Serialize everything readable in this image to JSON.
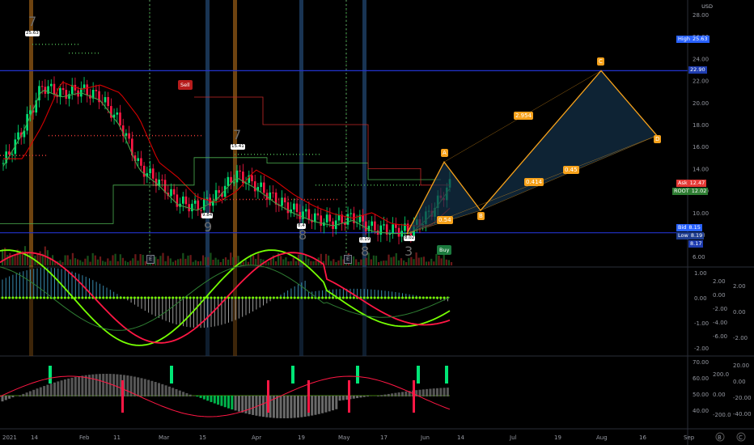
{
  "currency": "USD",
  "price_axis": {
    "labels": [
      "28.00",
      "26.00",
      "24.00",
      "22.00",
      "20.00",
      "18.00",
      "16.00",
      "14.00",
      "12.00",
      "10.00",
      "8.00",
      "6.00"
    ],
    "tags": {
      "high": {
        "k": "High",
        "v": "25.63",
        "color": "#2962ff"
      },
      "level_upper": {
        "v": "22.90",
        "color": "#1e3caf"
      },
      "ask": {
        "k": "Ask",
        "v": "12.47",
        "color": "#e53935"
      },
      "root": {
        "k": "ROOT",
        "v": "12.02",
        "color": "#2e7d32"
      },
      "bid": {
        "k": "Bid",
        "v": "8.15",
        "color": "#2962ff"
      },
      "low": {
        "k": "Low",
        "v": "8.19",
        "color": "#1e3c8f"
      },
      "level_lower": {
        "v": "8.17",
        "color": "#1e3caf"
      }
    }
  },
  "osc1_axis": {
    "left": [
      "1.00",
      "0.00",
      "-1.00",
      "-2.00"
    ],
    "mid": [
      "2.00",
      "0.00",
      "-2.00",
      "-4.00",
      "-6.00"
    ],
    "right": [
      "2.00",
      "0.00",
      "-2.00"
    ]
  },
  "osc2_axis": {
    "left": [
      "70.00",
      "60.00",
      "50.00",
      "40.00"
    ],
    "mid": [
      "200.0",
      "0.00",
      "-200.0"
    ],
    "right": [
      "20.00",
      "0.00",
      "-20.00",
      "-40.00"
    ]
  },
  "time_axis": [
    "2021",
    "14",
    "Feb",
    "11",
    "Mar",
    "15",
    "Apr",
    "19",
    "May",
    "17",
    "Jun",
    "14",
    "Jul",
    "19",
    "Aug",
    "16",
    "Sep"
  ],
  "time_icons": [
    "B",
    "C"
  ],
  "annotations": {
    "sell": "Sell",
    "buy": "Buy",
    "earnings": "E",
    "price_marks": [
      "25.63",
      "15.41",
      "9.84",
      "8.4",
      "8.19",
      "8.02"
    ],
    "count_marks": [
      "7",
      "7",
      "9",
      "8",
      "8",
      "3"
    ]
  },
  "harmonic": {
    "points": [
      "A",
      "B",
      "C",
      "D"
    ],
    "ratios": [
      "2.954",
      "0.414",
      "0.45",
      "0.54"
    ],
    "color": "#f7a21b"
  },
  "colors": {
    "bull": "#00e676",
    "bear": "#ff1744",
    "grid": "#1e222d",
    "accent": "#f7a21b"
  },
  "chart_data": {
    "type": "candlestick",
    "title": "",
    "ylim": [
      5.5,
      28
    ],
    "x_categories": [
      "2021",
      "14",
      "Feb",
      "11",
      "Mar",
      "15",
      "Apr",
      "19",
      "May",
      "17",
      "Jun",
      "14"
    ],
    "close_approx": [
      14.5,
      17.5,
      21.5,
      20.8,
      21.2,
      20.5,
      18.2,
      14.2,
      12.8,
      11.0,
      10.5,
      11.5,
      13.5,
      12.5,
      11.2,
      10.2,
      9.5,
      9.1,
      9.6,
      8.6,
      8.4,
      8.4,
      10.0,
      12.5
    ],
    "levels": {
      "high": 25.63,
      "upper": 22.9,
      "ask": 12.47,
      "root": 12.02,
      "bid": 8.15,
      "low": 8.19,
      "lower": 8.17
    }
  }
}
